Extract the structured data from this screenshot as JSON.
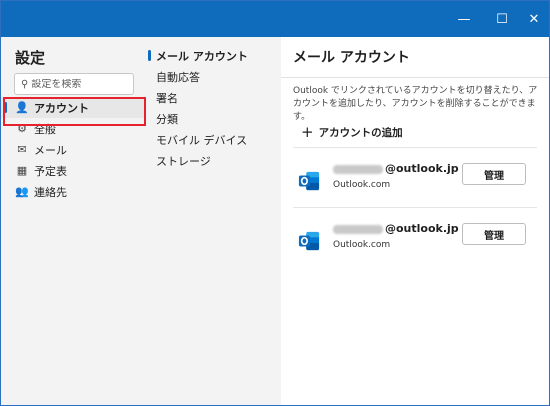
{
  "window": {
    "controls": {
      "minimize": "—",
      "maximize": "☐",
      "close": "✕"
    }
  },
  "nav": {
    "title": "設定",
    "search_placeholder": "設定を検索",
    "items": [
      {
        "label": "アカウント",
        "icon": "person-icon",
        "glyph": "👤",
        "active": true
      },
      {
        "label": "全般",
        "icon": "gear-icon",
        "glyph": "⚙",
        "active": false
      },
      {
        "label": "メール",
        "icon": "mail-icon",
        "glyph": "✉",
        "active": false
      },
      {
        "label": "予定表",
        "icon": "calendar-icon",
        "glyph": "▦",
        "active": false
      },
      {
        "label": "連絡先",
        "icon": "people-icon",
        "glyph": "👥",
        "active": false
      }
    ]
  },
  "subnav": {
    "items": [
      {
        "label": "メール アカウント",
        "active": true
      },
      {
        "label": "自動応答",
        "active": false
      },
      {
        "label": "署名",
        "active": false
      },
      {
        "label": "分類",
        "active": false
      },
      {
        "label": "モバイル デバイス",
        "active": false
      },
      {
        "label": "ストレージ",
        "active": false
      }
    ]
  },
  "main": {
    "title": "メール アカウント",
    "description": "Outlook でリンクされているアカウントを切り替えたり、アカウントを追加したり、アカウントを削除することができます。",
    "add_account_label": "アカウントの追加",
    "accounts": [
      {
        "email_domain": "@outlook.jp",
        "type": "Outlook.com",
        "manage_label": "管理"
      },
      {
        "email_domain": "@outlook.jp",
        "type": "Outlook.com",
        "manage_label": "管理"
      }
    ]
  },
  "colors": {
    "titlebar": "#0f6cbd",
    "accent": "#0f6cbd",
    "highlight_box": "#e6222e"
  }
}
